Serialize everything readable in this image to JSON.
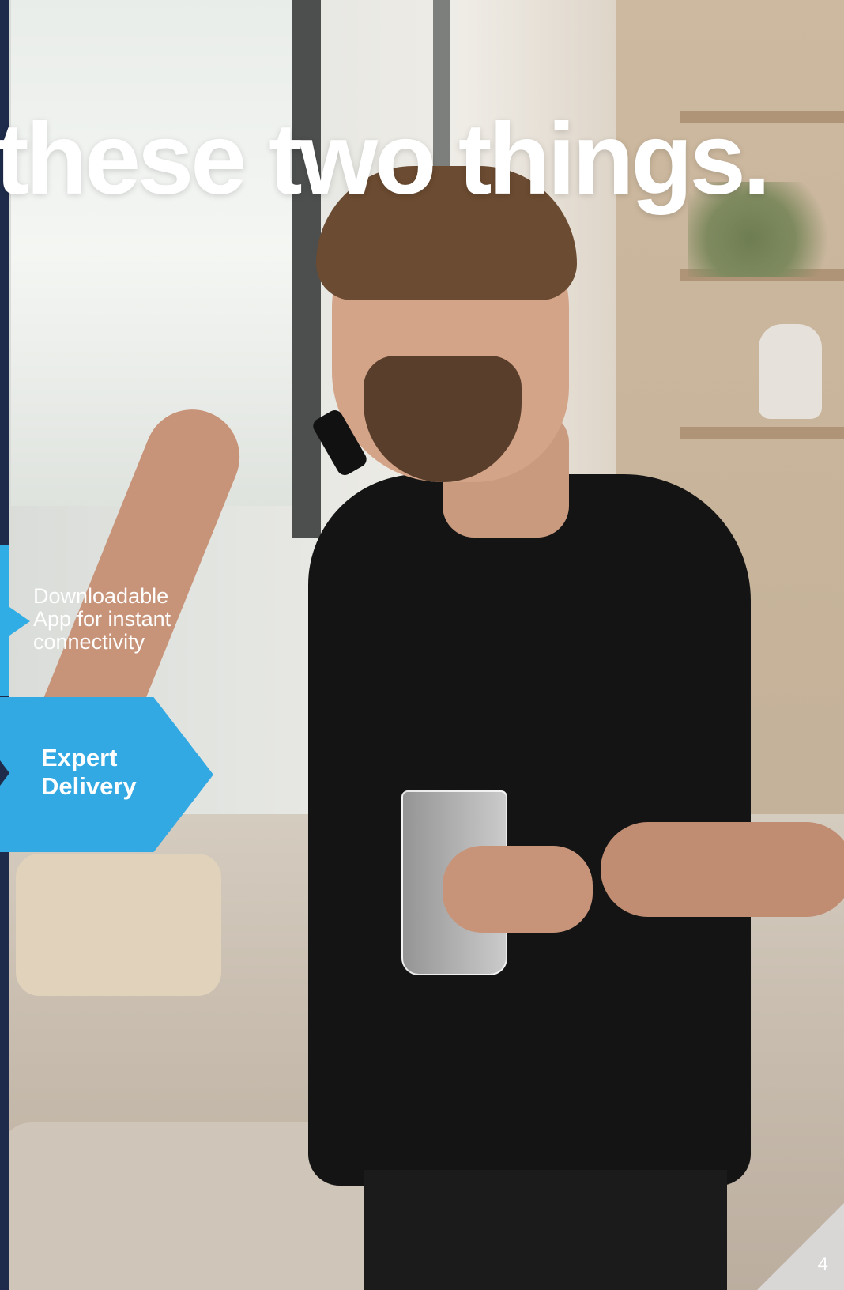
{
  "headline": "these two things.",
  "features": [
    {
      "text": "Downloadable App for instant connectivity"
    },
    {
      "text": "Expert Delivery"
    }
  ],
  "page_number": "4",
  "colors": {
    "accent_blue": "#31ade5",
    "text_white": "#ffffff",
    "dark_navy": "#1e2b4a"
  }
}
